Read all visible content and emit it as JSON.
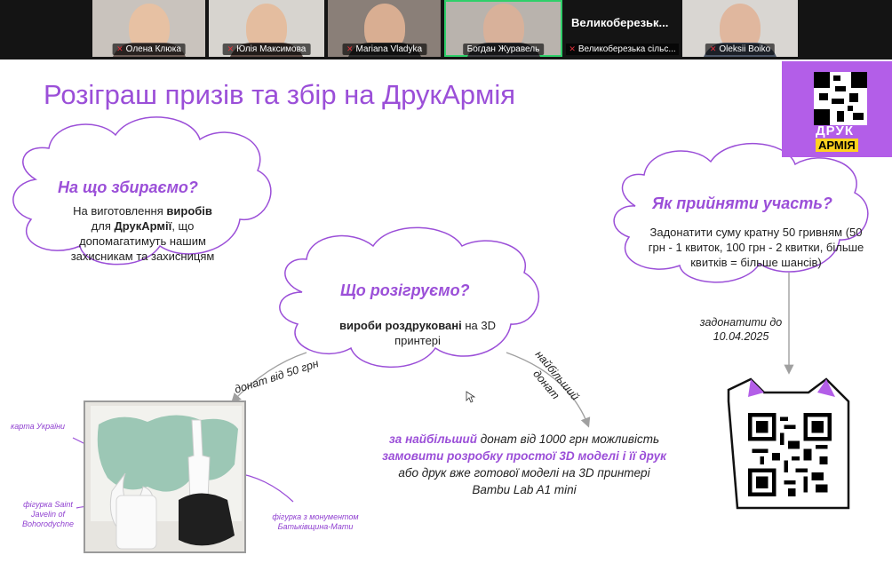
{
  "participants": [
    {
      "name": "Олена Клюка"
    },
    {
      "name": "Юлія Максимова"
    },
    {
      "name": "Mariana Vladyka"
    },
    {
      "name": "Богдан Журавель"
    },
    {
      "name": "Великоберезька сільс...",
      "display": "Великоберезьк..."
    },
    {
      "name": "Oleksii Boiko"
    }
  ],
  "slide": {
    "title": "Розіграш призів та збір на ДрукАрмія",
    "logo": {
      "line1": "ДРУК",
      "line2": "АРМІЯ"
    },
    "collect": {
      "heading": "На що збираємо?",
      "t1": "На виготовлення ",
      "b1": "виробів",
      "t2": "для ",
      "b2": "ДрукАрмії",
      "t3": ", що допомагатимуть нашим захисникам та захисницям"
    },
    "raffle": {
      "heading": "Що розігруємо?",
      "bold": "вироби роздруковані",
      "rest": " на 3D принтері"
    },
    "participate": {
      "heading": "Як прийняти участь?",
      "body": "Задонатити суму кратну 50 гривням (50 грн - 1 квиток, 100 грн - 2 квитки, більше квитків = більше шансів)"
    },
    "arrow_left": "донат від 50 грн",
    "arrow_mid": "найбільший донат",
    "deadline": {
      "line1": "задонатити до",
      "line2": "10.04.2025"
    },
    "prize": {
      "b1": "за найбільший",
      "t1": " донат від 1000 грн можливість ",
      "b2": "замовити розробку простої 3D моделі і її друк",
      "t2": " або друк вже готової моделі на 3D принтері Bambu Lab A1 mini"
    },
    "photo_labels": {
      "map": "карта України",
      "javelin": "фігурка Saint Javelin of Bohorodychne",
      "monument": "фігурка з монументом Батьківщина-Мати"
    }
  }
}
